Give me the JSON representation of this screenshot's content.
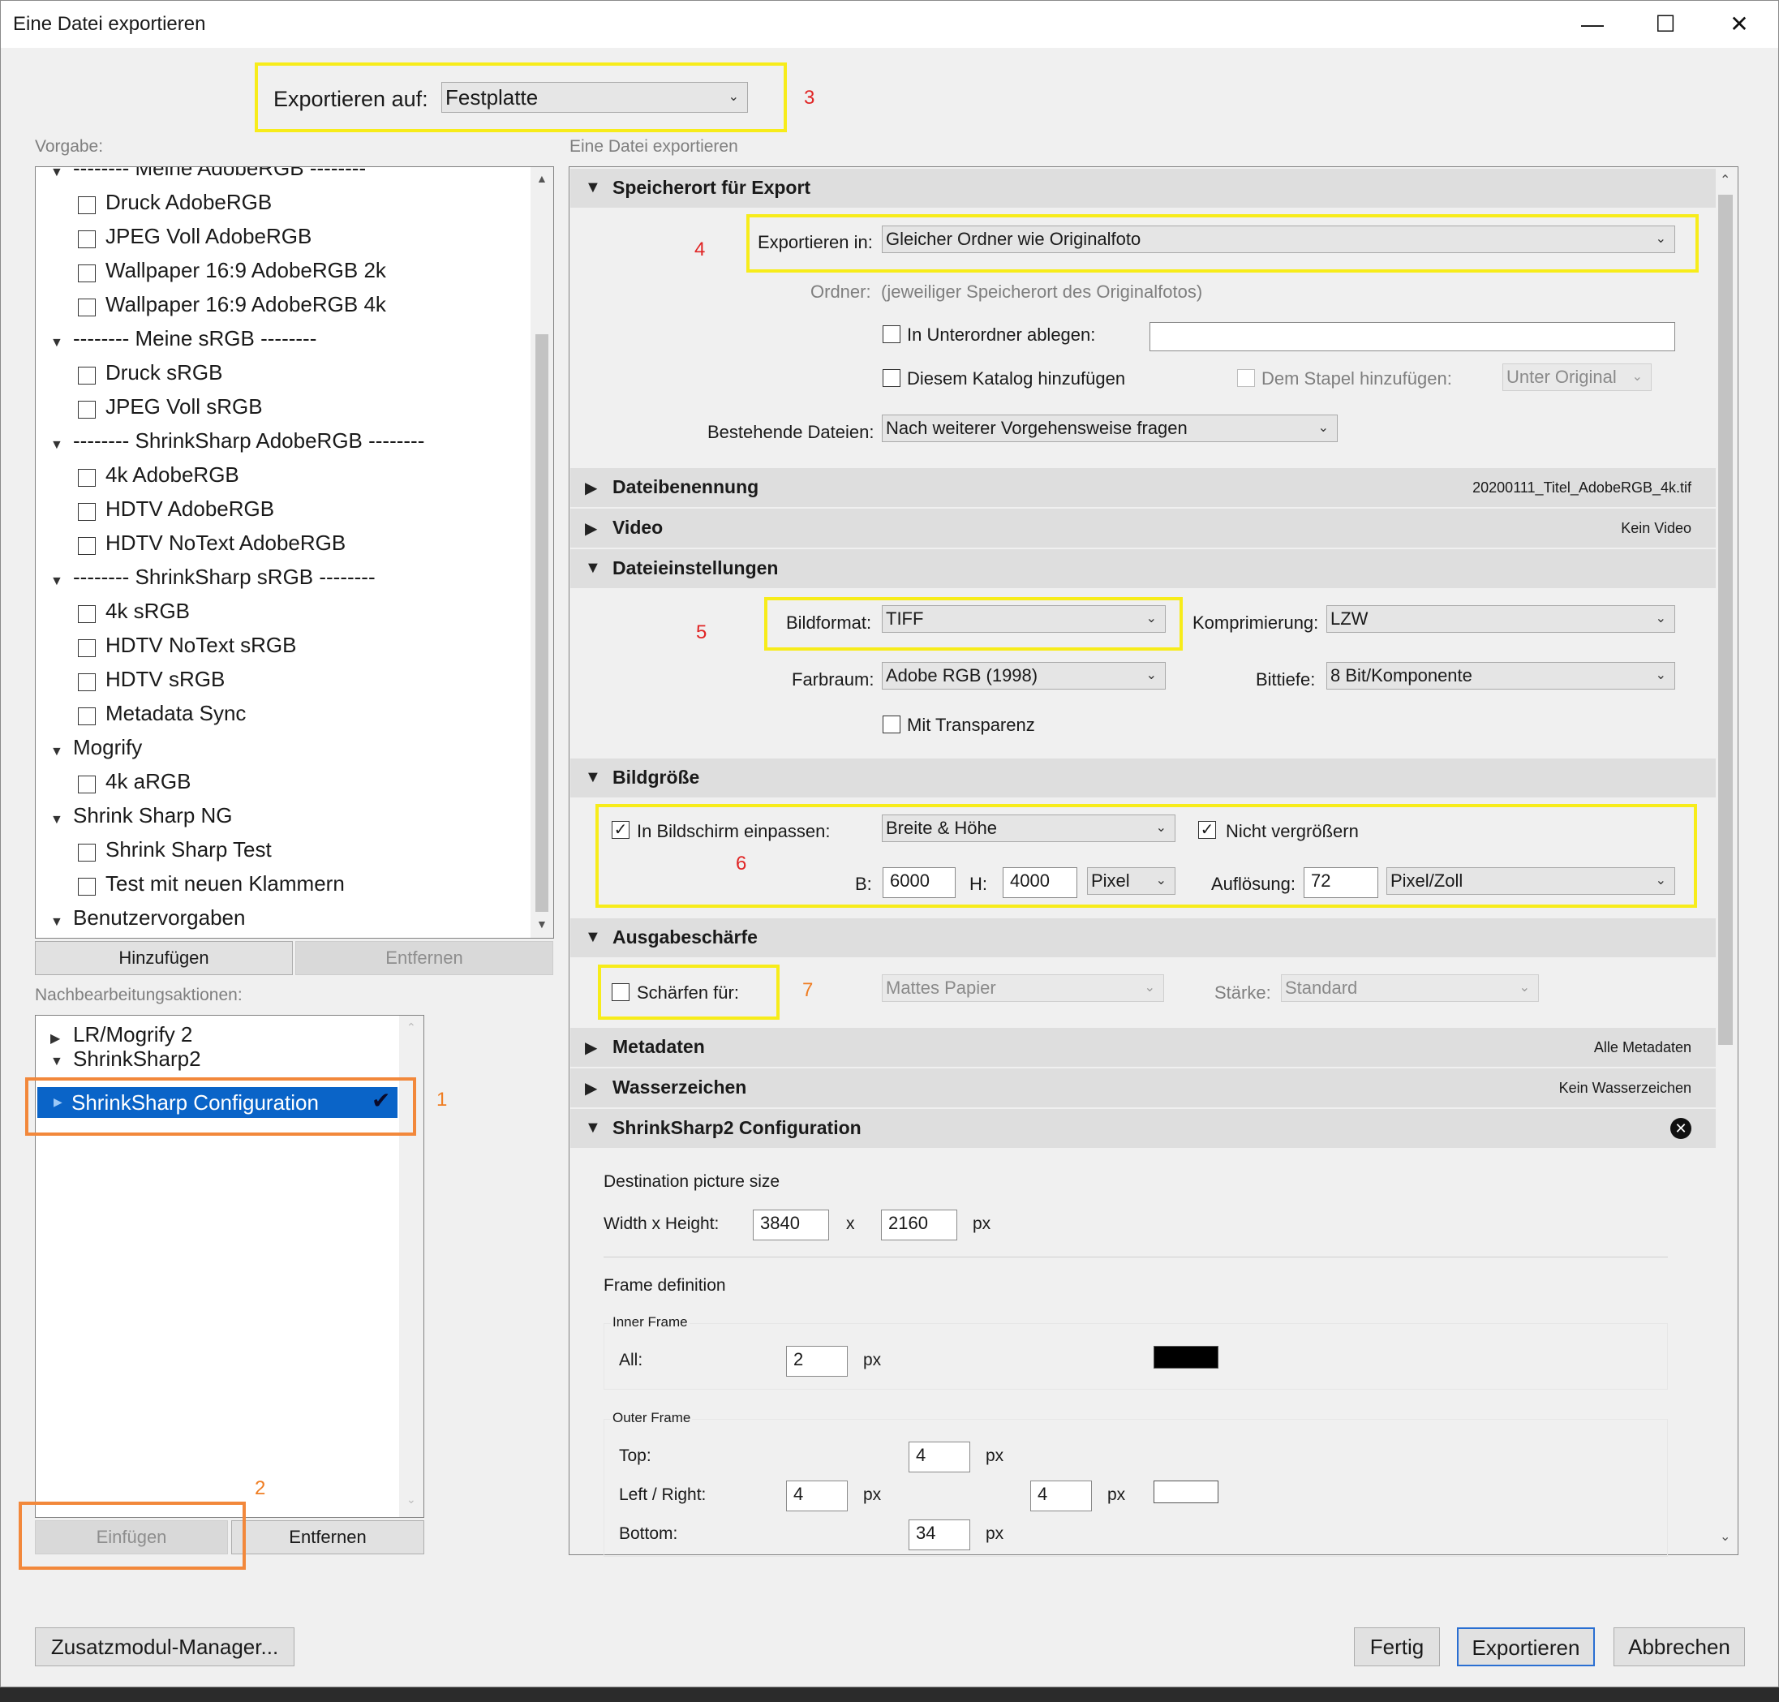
{
  "window": {
    "title": "Eine Datei exportieren",
    "minimize_glyph": "—",
    "maximize_glyph": "☐",
    "close_glyph": "✕"
  },
  "export_to": {
    "label": "Exportieren auf:",
    "value": "Festplatte"
  },
  "annotations": [
    "1",
    "2",
    "3",
    "4",
    "5",
    "6",
    "7"
  ],
  "presets": {
    "label": "Vorgabe:",
    "items": [
      {
        "type": "folder",
        "label": "-------- Meine AdobeRGB --------"
      },
      {
        "type": "preset",
        "label": "Druck AdobeRGB"
      },
      {
        "type": "preset",
        "label": "JPEG Voll AdobeRGB"
      },
      {
        "type": "preset",
        "label": "Wallpaper 16:9 AdobeRGB 2k"
      },
      {
        "type": "preset",
        "label": "Wallpaper 16:9 AdobeRGB 4k"
      },
      {
        "type": "folder",
        "label": "-------- Meine sRGB --------"
      },
      {
        "type": "preset",
        "label": "Druck sRGB"
      },
      {
        "type": "preset",
        "label": "JPEG Voll sRGB"
      },
      {
        "type": "folder",
        "label": "-------- ShrinkSharp AdobeRGB --------"
      },
      {
        "type": "preset",
        "label": "4k AdobeRGB"
      },
      {
        "type": "preset",
        "label": "HDTV AdobeRGB"
      },
      {
        "type": "preset",
        "label": "HDTV NoText AdobeRGB"
      },
      {
        "type": "folder",
        "label": "-------- ShrinkSharp sRGB --------"
      },
      {
        "type": "preset",
        "label": "4k sRGB"
      },
      {
        "type": "preset",
        "label": "HDTV NoText sRGB"
      },
      {
        "type": "preset",
        "label": "HDTV sRGB"
      },
      {
        "type": "preset",
        "label": "Metadata Sync"
      },
      {
        "type": "folder",
        "label": "Mogrify"
      },
      {
        "type": "preset",
        "label": "4k aRGB"
      },
      {
        "type": "folder",
        "label": "Shrink Sharp NG"
      },
      {
        "type": "preset",
        "label": "Shrink Sharp Test"
      },
      {
        "type": "preset",
        "label": "Test mit neuen Klammern"
      },
      {
        "type": "folder",
        "label": "Benutzervorgaben"
      }
    ],
    "add_button": "Hinzufügen",
    "remove_button": "Entfernen"
  },
  "post_actions": {
    "label": "Nachbearbeitungsaktionen:",
    "items": [
      {
        "label": "LR/Mogrify 2",
        "expanded": false
      },
      {
        "label": "ShrinkSharp2",
        "expanded": true
      },
      {
        "label": "ShrinkSharp Configuration",
        "selected": true,
        "check": "✔"
      }
    ],
    "insert_button": "Einfügen",
    "remove_button": "Entfernen"
  },
  "right_header": "Eine Datei exportieren",
  "sections": {
    "location": {
      "title": "Speicherort für Export",
      "export_in_label": "Exportieren in:",
      "export_in_value": "Gleicher Ordner wie Originalfoto",
      "folder_label": "Ordner:",
      "folder_value": "(jeweiliger Speicherort des Originalfotos)",
      "subfolder_label": "In Unterordner ablegen:",
      "catalog_label": "Diesem Katalog hinzufügen",
      "stack_label": "Dem Stapel hinzufügen:",
      "stack_value": "Unter Original",
      "existing_label": "Bestehende Dateien:",
      "existing_value": "Nach weiterer Vorgehensweise fragen"
    },
    "naming": {
      "title": "Dateibenennung",
      "summary": "20200111_Titel_AdobeRGB_4k.tif"
    },
    "video": {
      "title": "Video",
      "summary": "Kein Video"
    },
    "file_settings": {
      "title": "Dateieinstellungen",
      "format_label": "Bildformat:",
      "format_value": "TIFF",
      "compression_label": "Komprimierung:",
      "compression_value": "LZW",
      "colorspace_label": "Farbraum:",
      "colorspace_value": "Adobe RGB (1998)",
      "bitdepth_label": "Bittiefe:",
      "bitdepth_value": "8 Bit/Komponente",
      "transparency_label": "Mit Transparenz"
    },
    "image_size": {
      "title": "Bildgröße",
      "fit_label": "In Bildschirm einpassen:",
      "fit_value": "Breite & Höhe",
      "no_enlarge_label": "Nicht vergrößern",
      "w_label": "B:",
      "w_value": "6000",
      "h_label": "H:",
      "h_value": "4000",
      "unit_value": "Pixel",
      "res_label": "Auflösung:",
      "res_value": "72",
      "res_unit_value": "Pixel/Zoll"
    },
    "sharpening": {
      "title": "Ausgabeschärfe",
      "sharpen_label": "Schärfen für:",
      "sharpen_value": "Mattes Papier",
      "strength_label": "Stärke:",
      "strength_value": "Standard"
    },
    "metadata": {
      "title": "Metadaten",
      "summary": "Alle Metadaten"
    },
    "watermark": {
      "title": "Wasserzeichen",
      "summary": "Kein Wasserzeichen"
    },
    "shrinksharp": {
      "title": "ShrinkSharp2 Configuration",
      "dest_label": "Destination picture size",
      "wh_label": "Width x Height:",
      "width": "3840",
      "x_label": "x",
      "height": "2160",
      "px": "px",
      "frame_label": "Frame definition",
      "inner_label": "Inner Frame",
      "all_label": "All:",
      "all_value": "2",
      "outer_label": "Outer Frame",
      "top_label": "Top:",
      "top_value": "4",
      "lr_label": "Left / Right:",
      "left_value": "4",
      "right_value": "4",
      "bottom_label": "Bottom:",
      "bottom_value": "34",
      "inner_color": "#000000",
      "outer_color": "#ffffff"
    }
  },
  "footer": {
    "plugin_manager": "Zusatzmodul-Manager...",
    "done": "Fertig",
    "export": "Exportieren",
    "cancel": "Abbrechen"
  },
  "colors": {
    "highlight_yellow": "#f7ec1a",
    "highlight_orange": "#f2883b",
    "selection_blue": "#0a64c8",
    "annotation_red": "#e02525",
    "annotation_orange": "#ef7d22"
  }
}
